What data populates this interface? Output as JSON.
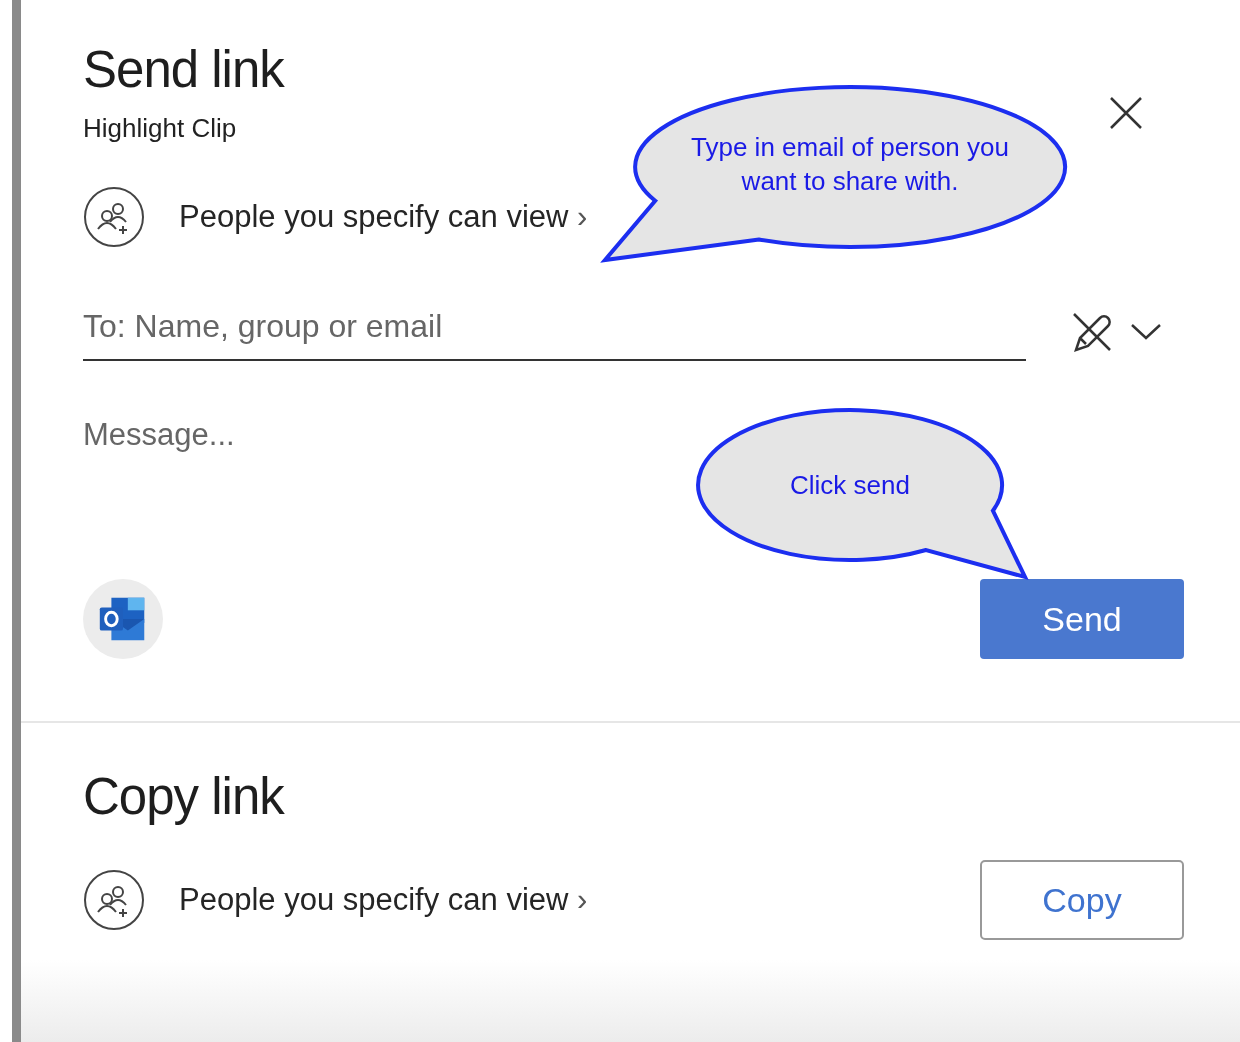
{
  "send_section": {
    "title": "Send link",
    "subtitle": "Highlight Clip",
    "permission": {
      "label": "People you specify can view",
      "chevron": "›"
    },
    "to_field": {
      "placeholder": "To: Name, group or email"
    },
    "message_field": {
      "placeholder": "Message..."
    },
    "send_button": "Send"
  },
  "copy_section": {
    "title": "Copy link",
    "permission": {
      "label": "People you specify can view",
      "chevron": "›"
    },
    "copy_button": "Copy"
  },
  "callouts": [
    {
      "text": "Type in email of person you want to share with."
    },
    {
      "text": "Click send"
    }
  ]
}
